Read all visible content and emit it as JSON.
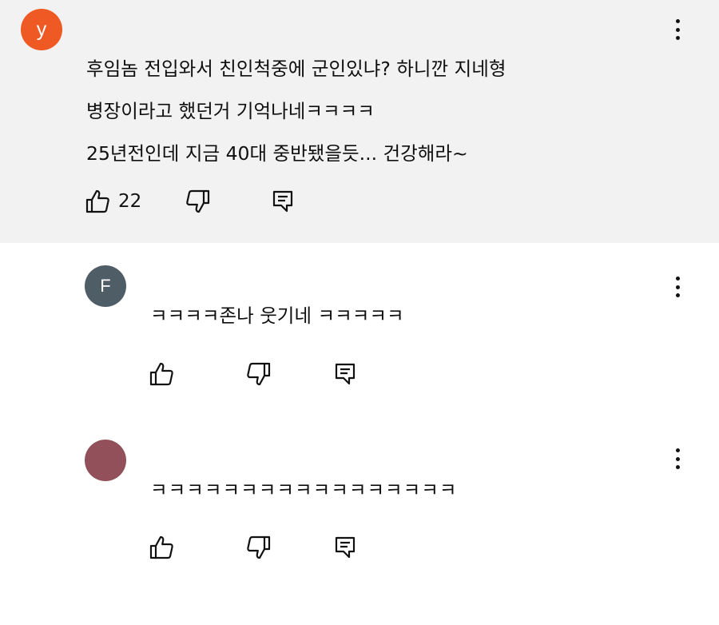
{
  "comments": [
    {
      "avatar_letter": "y",
      "avatar_color": "#ef5a24",
      "lines": [
        "후임놈 전입와서 친인척중에 군인있냐? 하니깐 지네형",
        "병장이라고 했던거 기억나네ㅋㅋㅋㅋ",
        "25년전인데 지금 40대 중반됐을듯... 건강해라~"
      ],
      "like_count": "22",
      "icons": {
        "like": "thumbs-up-icon",
        "dislike": "thumbs-down-icon",
        "reply": "reply-icon",
        "menu": "more-vert-icon"
      }
    },
    {
      "avatar_letter": "F",
      "avatar_color": "#4f5d66",
      "lines": [
        "ㅋㅋㅋㅋ존나 웃기네 ㅋㅋㅋㅋㅋ"
      ],
      "like_count": ""
    },
    {
      "avatar_letter": "",
      "avatar_color": "#92515a",
      "lines": [
        "ㅋㅋㅋㅋㅋㅋㅋㅋㅋㅋㅋㅋㅋㅋㅋㅋㅋ"
      ],
      "like_count": ""
    }
  ]
}
